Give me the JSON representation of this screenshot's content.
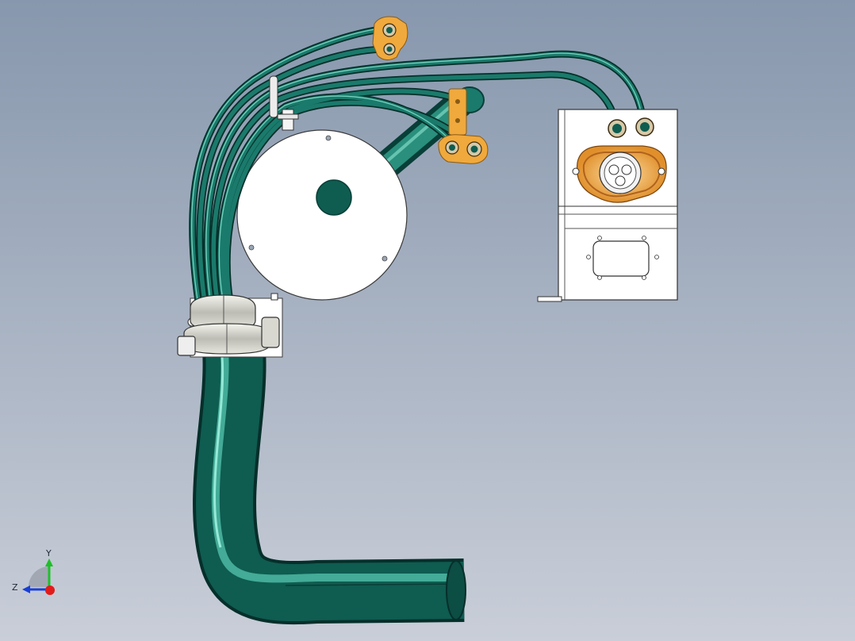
{
  "viewport": {
    "background_top": "#8797ad",
    "background_bottom": "#c9ced8"
  },
  "model": {
    "hose_color": "#0e5c52",
    "hose_highlight": "#6fd3bf",
    "bracket_color": "#f0a93c",
    "part_white": "#ffffff",
    "clamp_metal": "#c8c8c0"
  },
  "triad": {
    "y_label": "Y",
    "z_label": "Z",
    "y_color": "#1fbf2a",
    "z_color": "#1a3fd6",
    "x_color": "#e11b1b"
  }
}
